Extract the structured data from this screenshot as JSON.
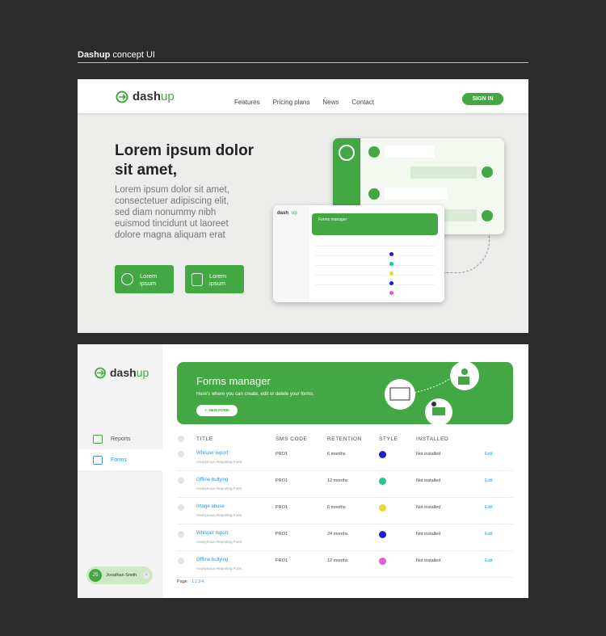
{
  "presentation": {
    "title_bold": "Dashup",
    "title_rest": " concept UI"
  },
  "brand": {
    "dash": "dash",
    "up": "up",
    "accent": "#43a843",
    "link": "#1a9aef"
  },
  "landing": {
    "nav": [
      "Features",
      "Pricing plans",
      "News",
      "Contact"
    ],
    "signin": "SIGN IN",
    "hero_title": "Lorem ipsum dolor sit amet,",
    "hero_body": "Lorem ipsum dolor sit amet, consectetuer adipiscing elit, sed diam nonummy nibh euismod tincidunt ut laoreet dolore magna aliquam erat",
    "cta1": "Lorem ipsum",
    "cta2": "Lorem ipsum",
    "mini_title": "Forms manager"
  },
  "app": {
    "sidebar": [
      {
        "label": "Reports",
        "icon": "chat-icon"
      },
      {
        "label": "Forms",
        "icon": "form-icon"
      }
    ],
    "user": {
      "initials": "JS",
      "name": "Jonathan Smith"
    },
    "banner": {
      "title": "Forms manager",
      "subtitle": "Here's where you can create, edit or delete your forms.",
      "button": "NEW FORM"
    },
    "columns": [
      "TITLE",
      "SMS CODE",
      "RETENTION",
      "STYLE",
      "INSTALLED"
    ],
    "rows": [
      {
        "title": "Whisper report",
        "sub": "Anonymous Reporting Form",
        "code": "PRO1",
        "retention": "6 months",
        "color": "#1b1fcf",
        "installed": "Not installed",
        "action": "Edit"
      },
      {
        "title": "Offline bullying",
        "sub": "Anonymous Reporting Form",
        "code": "PRO1",
        "retention": "12 months",
        "color": "#20c98a",
        "installed": "Not installed",
        "action": "Edit"
      },
      {
        "title": "Image abuse",
        "sub": "Anonymous Reporting Form",
        "code": "PRO1",
        "retention": "6 months",
        "color": "#e5df2a",
        "installed": "Not installed",
        "action": "Edit"
      },
      {
        "title": "Whisper report",
        "sub": "Anonymous Reporting Form",
        "code": "PRO1",
        "retention": "24 months",
        "color": "#1b1fcf",
        "installed": "Not installed",
        "action": "Edit"
      },
      {
        "title": "Offline bullying",
        "sub": "Anonymous Reporting Form",
        "code": "PRO1",
        "retention": "12 months",
        "color": "#e25dc8",
        "installed": "Not installed",
        "action": "Edit"
      }
    ],
    "pager": {
      "label": "Page",
      "pages": [
        "1",
        "2",
        "3",
        "4"
      ]
    }
  }
}
